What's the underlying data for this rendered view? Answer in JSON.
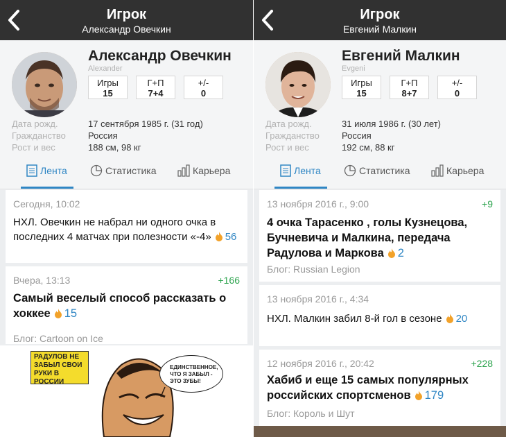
{
  "left": {
    "nav_title": "Игрок",
    "nav_subtitle": "Александр Овечкин",
    "name": "Александр Овечкин",
    "latin": "Alexander",
    "stats": [
      {
        "label": "Игры",
        "value": "15"
      },
      {
        "label": "Г+П",
        "value": "7+4"
      },
      {
        "label": "+/-",
        "value": "0"
      }
    ],
    "info": [
      {
        "label": "Дата рожд.",
        "value": "17 сентября 1985 г. (31 год)"
      },
      {
        "label": "Гражданство",
        "value": "Россия"
      },
      {
        "label": "Рост и вес",
        "value": "188 см, 98 кг"
      }
    ],
    "tabs": [
      "Лента",
      "Статистика",
      "Карьера"
    ],
    "feed": [
      {
        "date": "Сегодня, 10:02",
        "title": "НХЛ. Овечкин не набрал ни одного очка в последних 4 матчах при полезности «-4»",
        "count": "56"
      },
      {
        "date": "Вчера, 13:13",
        "delta": "+166",
        "title": "Самый веселый способ рассказать о хоккее",
        "count": "15",
        "blog": "Блог: Cartoon on Ice"
      }
    ],
    "comic": {
      "caption": "РАДУЛОВ НЕ ЗАБЫЛ СВОИ РУКИ В РОССИИ",
      "bubble": "ЕДИНСТВЕННОЕ, ЧТО Я ЗАБЫЛ - ЭТО ЗУБЫ!"
    }
  },
  "right": {
    "nav_title": "Игрок",
    "nav_subtitle": "Евгений Малкин",
    "name": "Евгений Малкин",
    "latin": "Evgeni",
    "stats": [
      {
        "label": "Игры",
        "value": "15"
      },
      {
        "label": "Г+П",
        "value": "8+7"
      },
      {
        "label": "+/-",
        "value": "0"
      }
    ],
    "info": [
      {
        "label": "Дата рожд.",
        "value": "31 июля 1986 г. (30 лет)"
      },
      {
        "label": "Гражданство",
        "value": "Россия"
      },
      {
        "label": "Рост и вес",
        "value": "192 см, 88 кг"
      }
    ],
    "tabs": [
      "Лента",
      "Статистика",
      "Карьера"
    ],
    "feed": [
      {
        "date": "13 ноября 2016 г., 9:00",
        "delta": "+9",
        "title": "4 очка Тарасенко , голы Кузнецова, Бучневича и Малкина, передача Радулова и Маркова",
        "count": "2",
        "blog": "Блог: Russian Legion"
      },
      {
        "date": "13 ноября 2016 г., 4:34",
        "title": "НХЛ. Малкин забил 8-й гол в сезоне",
        "count": "20"
      },
      {
        "date": "12 ноября 2016 г., 20:42",
        "delta": "+228",
        "title": "Хабиб и еще 15 самых популярных российских спортсменов",
        "count": "179",
        "blog": "Блог: Король и Шут"
      }
    ]
  },
  "colors": {
    "navbar": "#313131",
    "accent": "#2f86c4",
    "positive": "#2ea44f",
    "muted": "#b2b2b2"
  },
  "icons": [
    "back-chevron-icon",
    "feed-icon",
    "pie-chart-icon",
    "bar-chart-icon",
    "fire-icon"
  ]
}
